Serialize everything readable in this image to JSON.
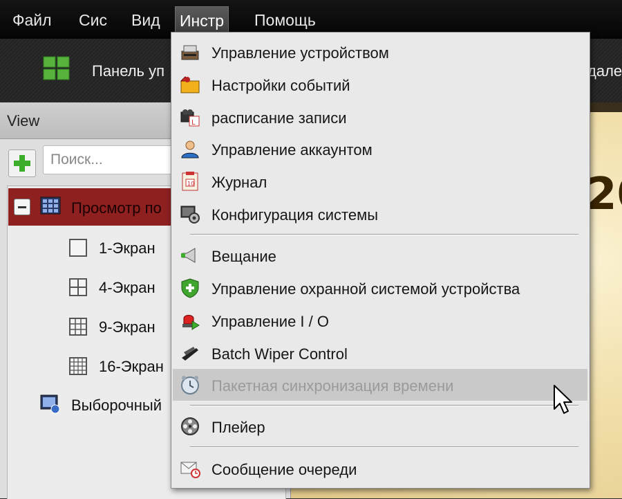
{
  "menubar": {
    "items": [
      "Файл",
      "Сис",
      "Вид",
      "Инстр",
      "Помощь"
    ],
    "active": "Инстр"
  },
  "toolbar": {
    "panel_label": "Панель уп",
    "right_label": "дале"
  },
  "left_panel": {
    "title": "View",
    "search_placeholder": "Поиск...",
    "tree": {
      "group_label": "Просмотр по",
      "children": [
        "1-Экран",
        "4-Экран",
        "9-Экран",
        "16-Экран"
      ],
      "custom_label": "Выборочный"
    }
  },
  "content": {
    "visible_text": "20"
  },
  "dropdown": {
    "items": [
      {
        "label": "Управление устройством",
        "icon": "device-management-icon"
      },
      {
        "label": "Настройки событий",
        "icon": "event-settings-icon"
      },
      {
        "label": "расписание записи",
        "icon": "record-schedule-icon"
      },
      {
        "label": "Управление аккаунтом",
        "icon": "account-icon"
      },
      {
        "label": "Журнал",
        "icon": "log-icon"
      },
      {
        "label": "Конфигурация системы",
        "icon": "system-config-icon"
      },
      {
        "label": "Вещание",
        "icon": "broadcast-icon"
      },
      {
        "label": "Управление охранной системой устройства",
        "icon": "security-shield-icon"
      },
      {
        "label": "Управление I / O",
        "icon": "io-alarm-icon"
      },
      {
        "label": "Batch Wiper Control",
        "icon": "wiper-icon"
      },
      {
        "label": "Пакетная синхронизация времени",
        "icon": "clock-icon",
        "state": "hovered-disabled"
      },
      {
        "label": "Плейер",
        "icon": "film-reel-icon"
      },
      {
        "label": "Сообщение очереди",
        "icon": "message-queue-icon"
      }
    ]
  },
  "colors": {
    "menubar_bg": "#0b0b0b",
    "selected_row": "#8f2020",
    "dropdown_bg": "#e9e9e9",
    "hover_bg": "#c9c9c9",
    "accent_green": "#3dae2b"
  }
}
